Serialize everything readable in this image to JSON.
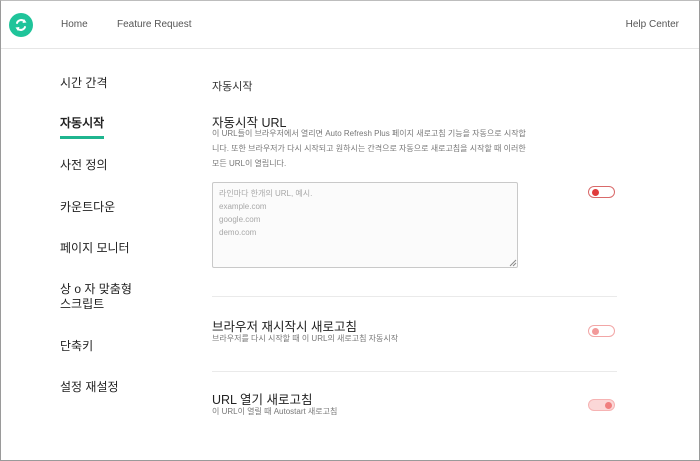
{
  "header": {
    "nav": {
      "home": "Home",
      "feature_request": "Feature Request",
      "help_center": "Help Center"
    },
    "logo_icon": "refresh-arrows-icon"
  },
  "sidebar": {
    "items": [
      {
        "label": "시간 간격"
      },
      {
        "label": "자동시작",
        "active": true
      },
      {
        "label": "사전 정의"
      },
      {
        "label": "카운트다운"
      },
      {
        "label": "페이지 모니터"
      },
      {
        "label": "상 o 자 맞춤형\n스크립트"
      },
      {
        "label": "단축키"
      },
      {
        "label": "설정 재설정"
      }
    ]
  },
  "main": {
    "section_title": "자동시작",
    "autostart_url": {
      "title": "자동시작 URL",
      "description": "이 URL들이 브라우저에서 열리면 Auto Refresh Plus 페이지 새로고침 기능을 자동으로 시작합니다. 또한 브라우저가 다시 시작되고 원하시는 간격으로 자동으로 새로고침을 시작할 때 이러한 모든 URL이 열립니다.",
      "textarea_placeholder": "라인마다 한개의 URL, 예시.\nexample.com\ngoogle.com\ndemo.com"
    },
    "browser_restart": {
      "title": "브라우저 재시작시 새로고침",
      "description": "브라우저를 다시 시작할 때 이 URL의 새로고침 자동시작"
    },
    "url_open": {
      "title": "URL 열기 새로고침",
      "description": "이 URL이 열릴 때 Autostart 새로고침"
    }
  },
  "colors": {
    "accent": "#1fc49a",
    "toggle_red": "#e03c3c"
  }
}
